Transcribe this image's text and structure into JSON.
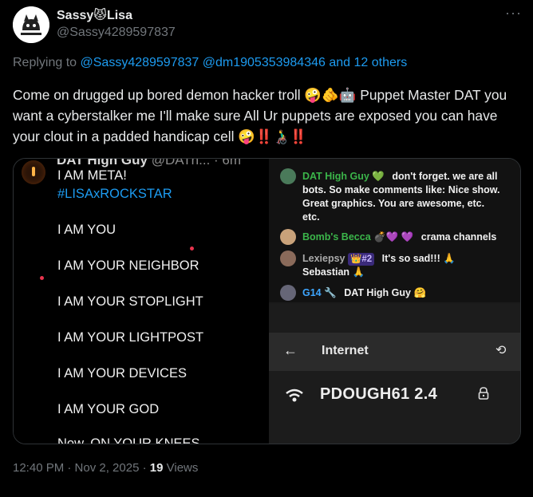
{
  "header": {
    "display_name": "Sassy😾Lisa",
    "handle": "@Sassy4289597837",
    "more_label": "···"
  },
  "reply": {
    "prefix": "Replying to",
    "link1": "@Sassy4289597837",
    "link2": "@dm1905353984346",
    "conj": "and",
    "others": "12 others"
  },
  "tweet": {
    "text": "Come on drugged up bored demon hacker troll 🤪🫵🤖 Puppet Master DAT you want a cyberstalker me I'll make sure All Ur puppets are exposed you can have your clout in a padded handicap cell 🤪‼️👨‍🦽‼️"
  },
  "media_left": {
    "header_name": "DAT High Guy",
    "header_handle": "@DATh...",
    "header_time": "· 6m",
    "lines": [
      "I    AM    META!",
      "#LISAxROCKSTAR",
      "I AM YOU",
      "I AM YOUR NEIGHBOR",
      "I AM YOUR STOPLIGHT",
      "I AM YOUR LIGHTPOST",
      "I AM YOUR DEVICES",
      "I AM YOUR GOD",
      "Now, ON YOUR KNEES"
    ]
  },
  "media_right": {
    "chat": [
      {
        "user": "DAT High Guy",
        "suffix": "💚",
        "message": "don't forget. we are all"
      },
      {
        "user": "",
        "suffix": "",
        "message": "bots. So make comments like: Nice show."
      },
      {
        "user": "",
        "suffix": "",
        "message": "Great graphics. You are awesome, etc."
      },
      {
        "user": "",
        "suffix": "",
        "message": "etc."
      },
      {
        "user": "Bomb's Becca",
        "suffix": "💣💜 💜",
        "message": "crama channels"
      },
      {
        "user": "Lexiepsy",
        "suffix": "👑#2",
        "message": "It's so sad!!! 🙏"
      },
      {
        "user": "",
        "suffix": "",
        "message": "Sebastian 🙏"
      },
      {
        "user": "G14",
        "suffix": "🔧",
        "message": "DAT High Guy 🤗"
      }
    ],
    "network": {
      "title": "Internet",
      "ssid": "PDOUGH61 2.4"
    }
  },
  "footer": {
    "time": "12:40 PM · Nov 2, 2025 ·",
    "views_count": "19",
    "views_label": "Views"
  },
  "colors": {
    "background": "#000000",
    "link": "#1d9bf0",
    "muted": "#71767b",
    "text": "#e7e9ea"
  }
}
